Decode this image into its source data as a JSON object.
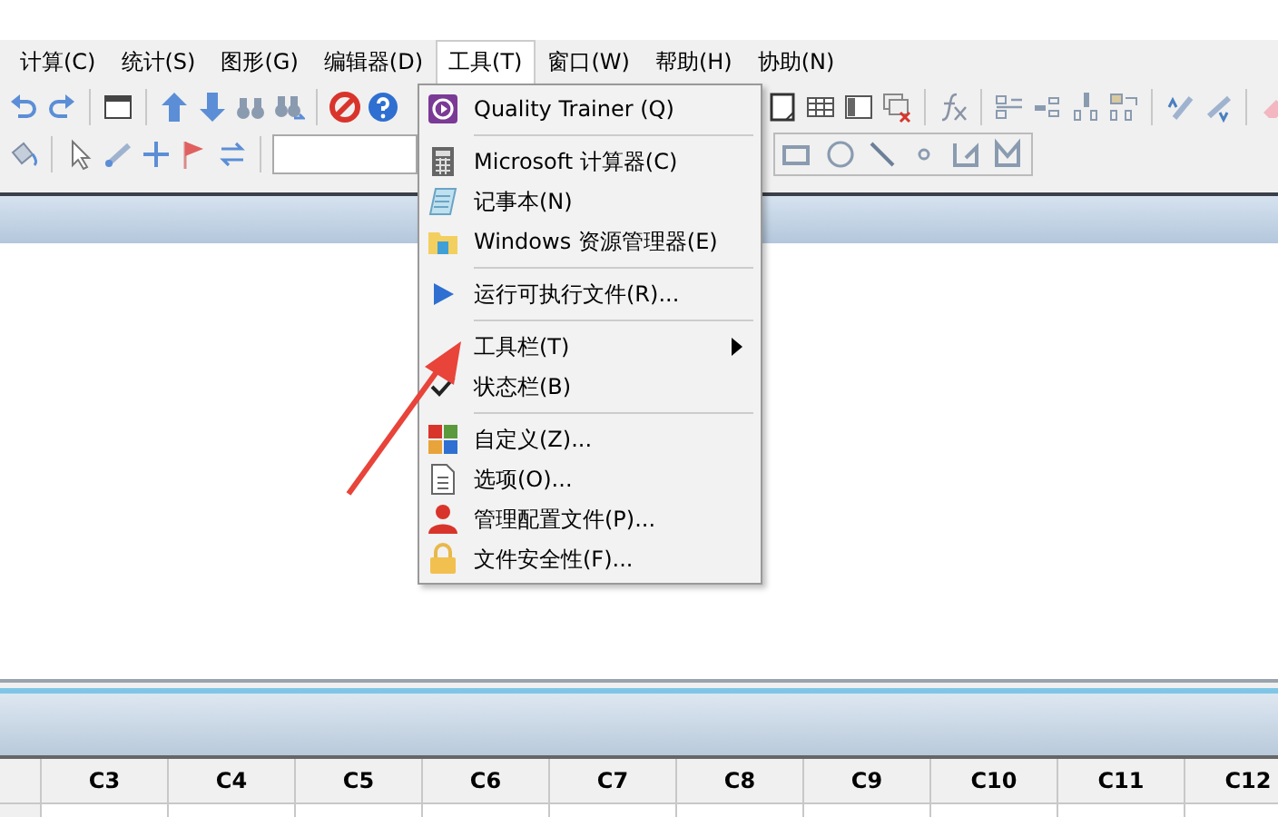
{
  "menu_bar": [
    {
      "label": "计算(C)",
      "selected": false
    },
    {
      "label": "统计(S)",
      "selected": false
    },
    {
      "label": "图形(G)",
      "selected": false
    },
    {
      "label": "编辑器(D)",
      "selected": false
    },
    {
      "label": "工具(T)",
      "selected": true
    },
    {
      "label": "窗口(W)",
      "selected": false
    },
    {
      "label": "帮助(H)",
      "selected": false
    },
    {
      "label": "协助(N)",
      "selected": false
    }
  ],
  "tools_menu": [
    {
      "kind": "item",
      "label": "Quality Trainer (Q)"
    },
    {
      "kind": "separator"
    },
    {
      "kind": "item",
      "label": "Microsoft 计算器(C)"
    },
    {
      "kind": "item",
      "label": "记事本(N)"
    },
    {
      "kind": "item",
      "label": "Windows 资源管理器(E)"
    },
    {
      "kind": "separator"
    },
    {
      "kind": "item",
      "label": "运行可执行文件(R)..."
    },
    {
      "kind": "separator"
    },
    {
      "kind": "submenu",
      "label": "工具栏(T)"
    },
    {
      "kind": "check",
      "label": "状态栏(B)",
      "checked": true
    },
    {
      "kind": "separator"
    },
    {
      "kind": "item",
      "label": "自定义(Z)..."
    },
    {
      "kind": "item",
      "label": "选项(O)..."
    },
    {
      "kind": "item",
      "label": "管理配置文件(P)..."
    },
    {
      "kind": "item",
      "label": "文件安全性(F)..."
    }
  ],
  "worksheet": {
    "columns": [
      "",
      "C3",
      "C4",
      "C5",
      "C6",
      "C7",
      "C8",
      "C9",
      "C10",
      "C11",
      "C12"
    ]
  }
}
